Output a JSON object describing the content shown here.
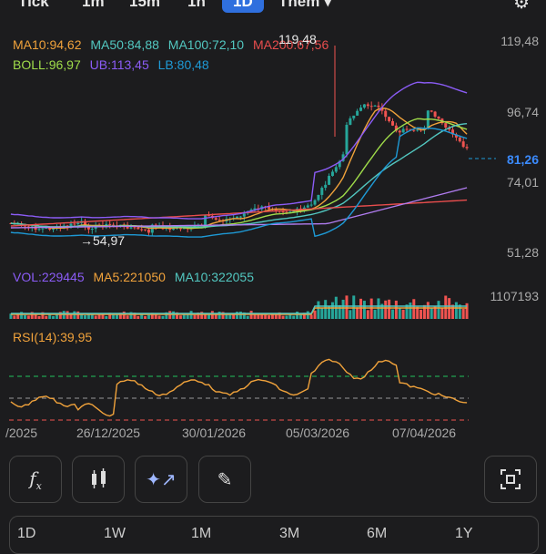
{
  "topbar": {
    "tabs": [
      "Tick",
      "1m",
      "15m",
      "1h",
      "1D",
      "Thêm ▾"
    ],
    "active": "1D"
  },
  "legend_ma": {
    "ma10": "MA10:94,62",
    "ma50": "MA50:84,88",
    "ma100": "MA100:72,10",
    "ma200": "MA200:67,56"
  },
  "legend_boll": {
    "boll": "BOLL:96,97",
    "ub": "UB:113,45",
    "lb": "LB:80,48"
  },
  "annotations": {
    "high_label": "119,48",
    "low_label": "54,97"
  },
  "price_axis": [
    "119,48",
    "96,74",
    "74,01",
    "51,28"
  ],
  "current_price": "81,26",
  "volume": {
    "vol": "VOL:229445",
    "ma5": "MA5:221050",
    "ma10": "MA10:322055",
    "axis_max": "1107193"
  },
  "rsi": {
    "label": "RSI(14):39,95"
  },
  "x_axis": [
    "/2025",
    "26/12/2025",
    "30/01/2026",
    "05/03/2026",
    "07/04/2026"
  ],
  "toolbar": {
    "fx": "fₓ",
    "candle": "candle",
    "ai": "sparkle",
    "draw": "pencil",
    "capture": "capture"
  },
  "ranges": [
    "1D",
    "1W",
    "1M",
    "3M",
    "6M",
    "1Y"
  ],
  "colors": {
    "up": "#26a69a",
    "down": "#ef5350",
    "ma10": "#f0a23b",
    "ma50": "#7ed957",
    "ma100": "#52c7c0",
    "ma200": "#e84d4d",
    "boll": "#9fdc4a",
    "ub": "#8b5cf6",
    "lb": "#1e9ad6",
    "accent": "#2f6fde"
  }
}
